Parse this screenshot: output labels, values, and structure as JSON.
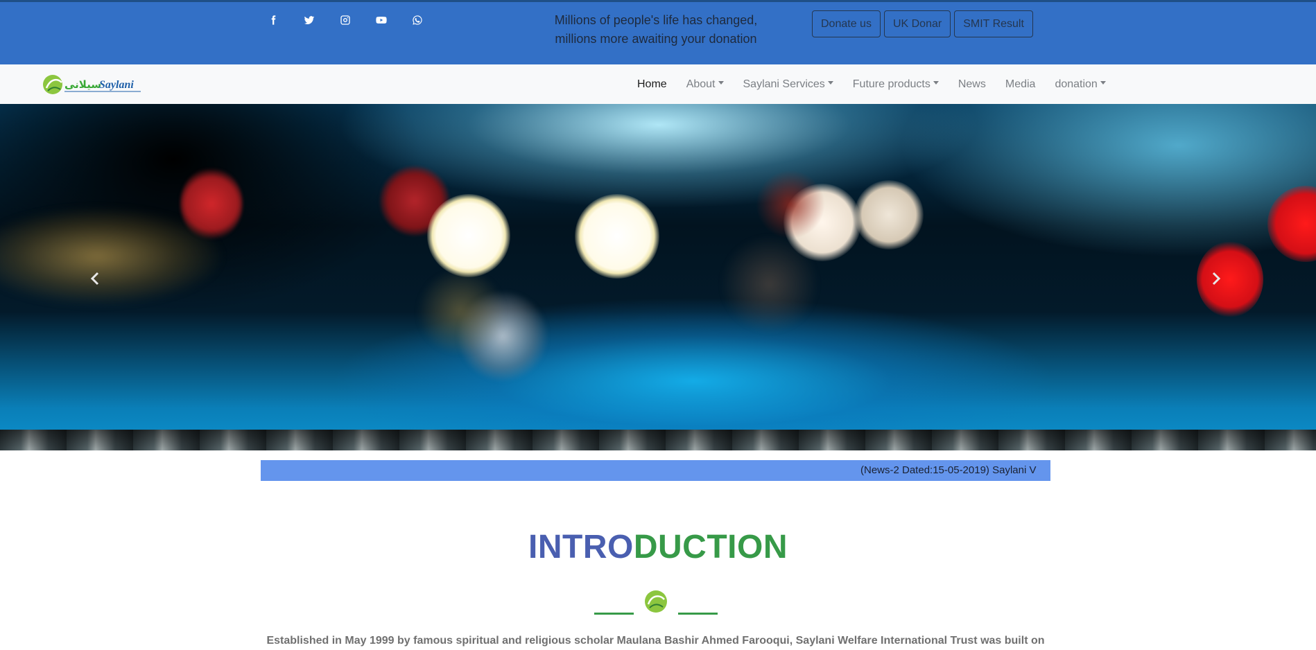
{
  "topbar": {
    "socials": [
      {
        "icon": "facebook-icon"
      },
      {
        "icon": "twitter-icon"
      },
      {
        "icon": "instagram-icon"
      },
      {
        "icon": "youtube-icon"
      },
      {
        "icon": "whatsapp-icon"
      }
    ],
    "tagline_line1": "Millions of people's life has changed,",
    "tagline_line2": "millions more awaiting your donation",
    "buttons": {
      "donate": "Donate us",
      "uk_donar": "UK Donar",
      "smit_result": "SMIT Result"
    },
    "colors": {
      "background": "#3370c6",
      "border_top": "#1f4f86"
    }
  },
  "navbar": {
    "logo_text": "Saylani",
    "logo_urdu": "سیلانی",
    "items": [
      {
        "label": "Home",
        "active": true,
        "dropdown": false
      },
      {
        "label": "About",
        "active": false,
        "dropdown": true
      },
      {
        "label": "Saylani Services",
        "active": false,
        "dropdown": true
      },
      {
        "label": "Future products",
        "active": false,
        "dropdown": true
      },
      {
        "label": "News",
        "active": false,
        "dropdown": false
      },
      {
        "label": "Media",
        "active": false,
        "dropdown": false
      },
      {
        "label": "donation",
        "active": false,
        "dropdown": true
      }
    ]
  },
  "carousel": {
    "prev_icon": "chevron-left-icon",
    "next_icon": "chevron-right-icon"
  },
  "ticker": {
    "text": "(News-2 Dated:15-05-2019) Saylani V",
    "background": "#6495ed"
  },
  "intro": {
    "title_part1": "INTRO",
    "title_part2": "DUCTION",
    "title_colors": [
      "#4a5fb0",
      "#379a48"
    ],
    "text": "Established in May 1999 by famous spiritual and religious scholar Maulana Bashir Ahmed Farooqui, Saylani Welfare International Trust was built on"
  }
}
